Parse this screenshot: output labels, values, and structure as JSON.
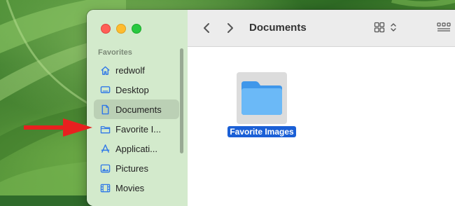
{
  "sidebar": {
    "section_header": "Favorites",
    "items": [
      {
        "label": "redwolf",
        "icon": "house-icon"
      },
      {
        "label": "Desktop",
        "icon": "desktop-icon"
      },
      {
        "label": "Documents",
        "icon": "document-icon",
        "active": true
      },
      {
        "label": "Favorite I...",
        "icon": "folder-icon"
      },
      {
        "label": "Applicati...",
        "icon": "applications-icon"
      },
      {
        "label": "Pictures",
        "icon": "pictures-icon"
      },
      {
        "label": "Movies",
        "icon": "movies-icon"
      }
    ]
  },
  "toolbar": {
    "title": "Documents",
    "back_icon": "chevron-left-icon",
    "forward_icon": "chevron-right-icon",
    "view_icon": "icon-grid-view-icon",
    "group_icon": "group-view-icon"
  },
  "content": {
    "items": [
      {
        "label": "Favorite Images",
        "icon": "folder-icon",
        "selected": true
      }
    ]
  },
  "colors": {
    "accent": "#1a5fd6",
    "folder": "#5aaef5",
    "arrow": "#e8201f",
    "sidebar_icon": "#2f78e8"
  }
}
